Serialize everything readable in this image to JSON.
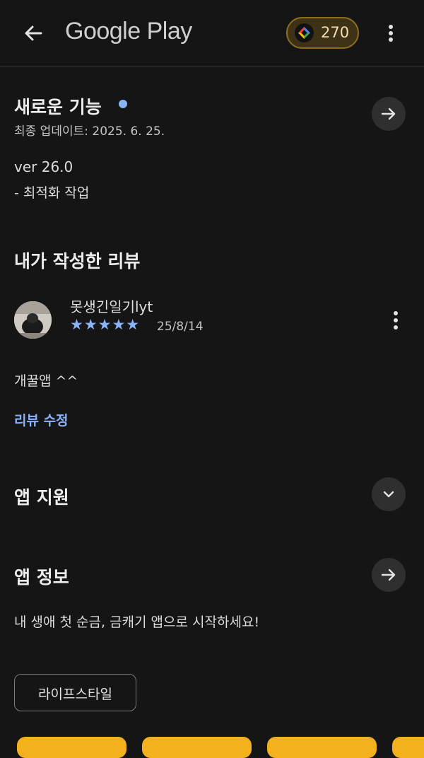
{
  "header": {
    "brand": "Google Play",
    "points": "270"
  },
  "whats_new": {
    "title": "새로운 기능",
    "last_updated": "최종 업데이트: 2025. 6. 25.",
    "version": "ver 26.0",
    "note": "- 최적화 작업"
  },
  "my_review": {
    "title": "내가 작성한 리뷰",
    "author": "못생긴일기lyt",
    "rating": 5,
    "stars": "★★★★★",
    "date": "25/8/14",
    "text": "개꿀앱 ^^",
    "edit_label": "리뷰 수정"
  },
  "app_support": {
    "title": "앱 지원"
  },
  "app_info": {
    "title": "앱 정보",
    "description": "내 생애 첫 순금, 금캐기 앱으로 시작하세요!",
    "category_chip": "라이프스타일"
  },
  "colors": {
    "background": "#151515",
    "accent_blue": "#8ab4f8",
    "points_gold": "#8b6d21",
    "thumbnail_yellow": "#f3b21d"
  },
  "icons": [
    "arrow-back-icon",
    "more-vert-icon",
    "play-points-icon",
    "arrow-forward-icon",
    "chevron-down-icon",
    "star-icon"
  ]
}
